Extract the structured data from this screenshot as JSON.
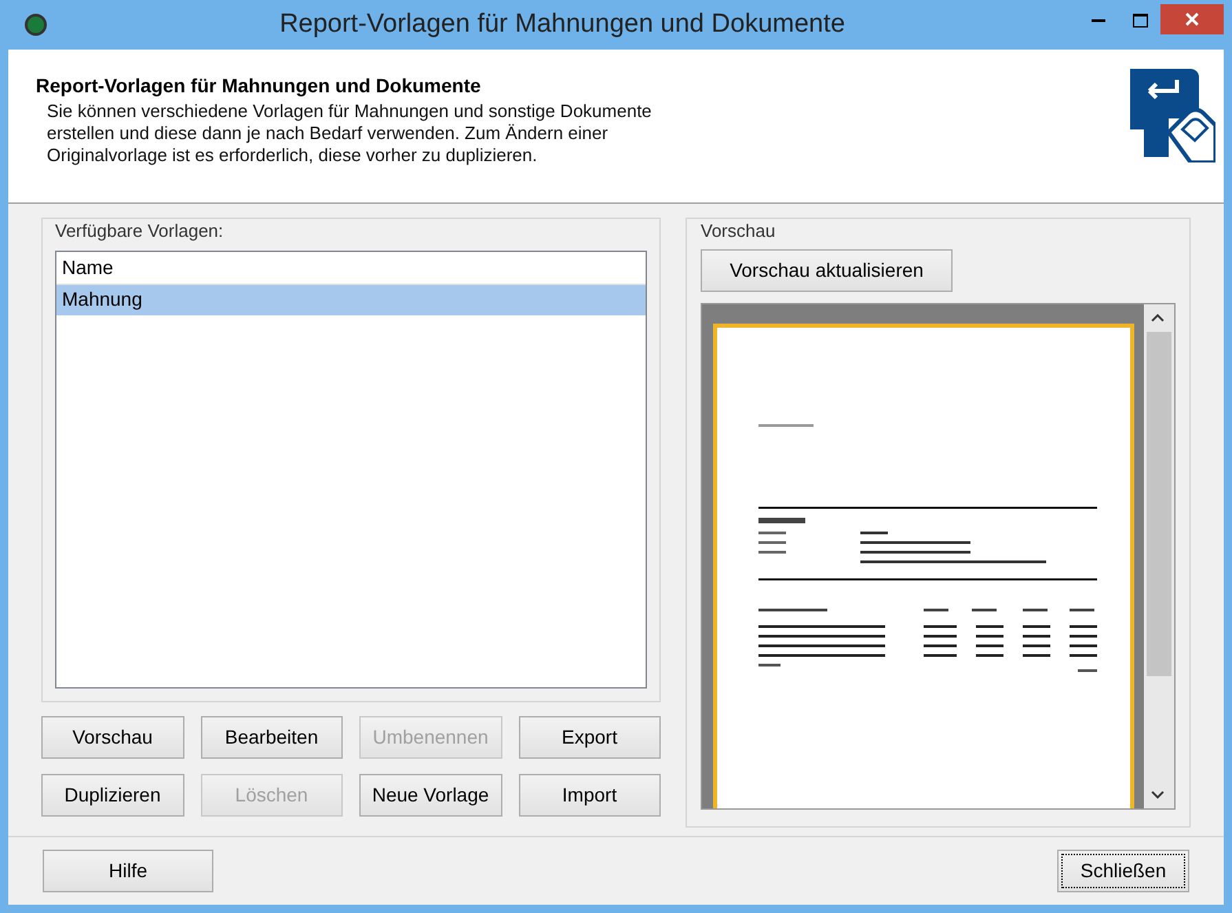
{
  "window": {
    "title": "Report-Vorlagen für Mahnungen und Dokumente"
  },
  "header": {
    "title": "Report-Vorlagen für Mahnungen und Dokumente",
    "description": "Sie können verschiedene Vorlagen für Mahnungen und sonstige Dokumente erstellen und diese dann je nach Bedarf verwenden. Zum Ändern einer Originalvorlage ist es erforderlich, diese vorher zu duplizieren."
  },
  "templates": {
    "label": "Verfügbare Vorlagen:",
    "column": "Name",
    "rows": [
      {
        "name": "Mahnung",
        "selected": true
      }
    ]
  },
  "template_buttons": [
    {
      "label": "Vorschau",
      "disabled": false
    },
    {
      "label": "Bearbeiten",
      "disabled": false
    },
    {
      "label": "Umbenennen",
      "disabled": true
    },
    {
      "label": "Export",
      "disabled": false
    },
    {
      "label": "Duplizieren",
      "disabled": false
    },
    {
      "label": "Löschen",
      "disabled": true
    },
    {
      "label": "Neue Vorlage",
      "disabled": false
    },
    {
      "label": "Import",
      "disabled": false
    }
  ],
  "preview": {
    "label": "Vorschau",
    "refresh_button": "Vorschau aktualisieren"
  },
  "footer": {
    "help_button": "Hilfe",
    "close_button": {
      "label": "Schließen",
      "focused": true
    }
  }
}
